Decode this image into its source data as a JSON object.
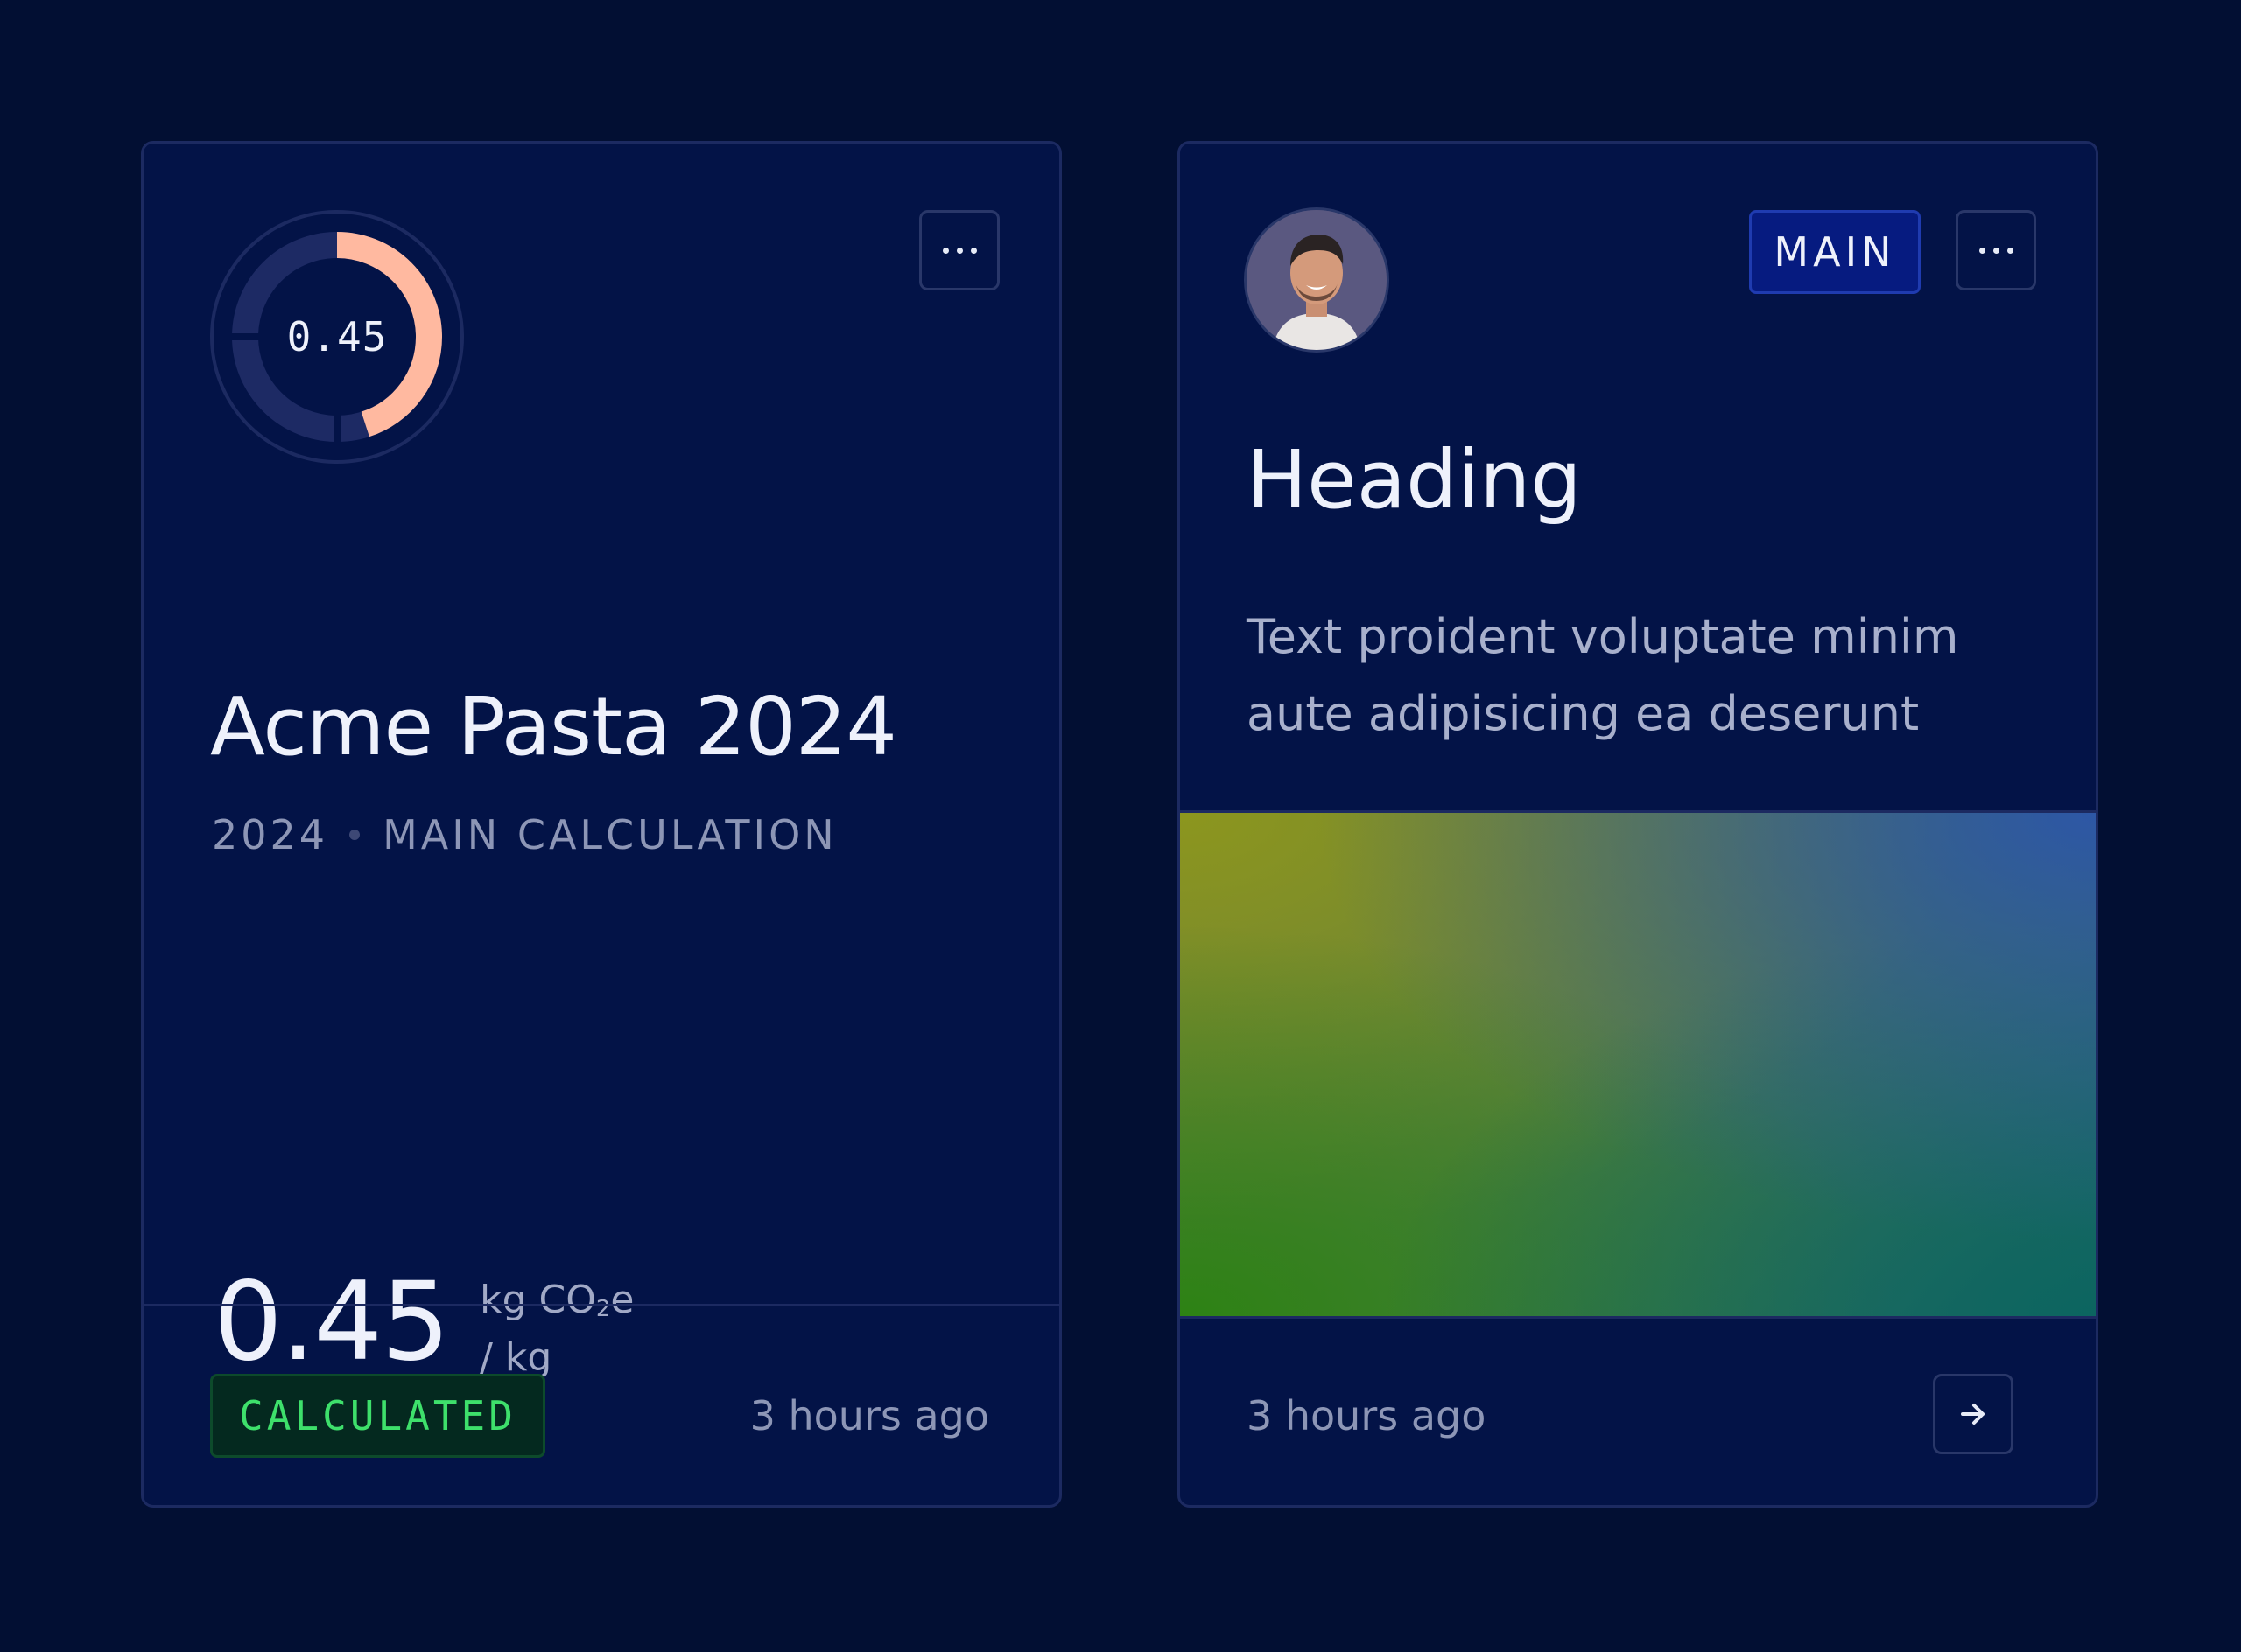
{
  "colors": {
    "background": "#020f33",
    "card": "#031347",
    "border": "#1c2a61",
    "accent_ring": "#ffb9a0",
    "success": "#3ee06b",
    "badge_main_bg": "#061b80"
  },
  "card_a": {
    "donut": {
      "value_label": "0.45",
      "fraction": 0.45
    },
    "title": "Acme Pasta 2024",
    "year": "2024",
    "calc_type": "MAIN CALCULATION",
    "metric_value": "0.45",
    "unit_line1_prefix": "kg CO",
    "unit_line1_sub": "2",
    "unit_line1_suffix": "e",
    "unit_line2": "/ kg",
    "status_badge": "CALCULATED",
    "updated": "3 hours ago",
    "menu_icon": "ellipsis-icon"
  },
  "card_b": {
    "badge": "MAIN",
    "heading": "Heading",
    "text": "Text proident voluptate minim aute adipisicing ea deserunt",
    "updated": "3 hours ago",
    "menu_icon": "ellipsis-icon",
    "action_icon": "arrow-right-icon",
    "avatar_icon": "avatar-photo"
  }
}
